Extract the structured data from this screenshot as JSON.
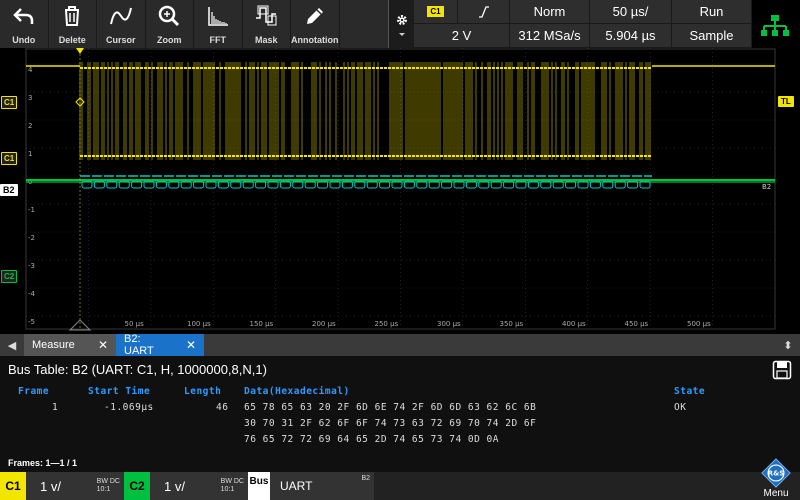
{
  "toolbar": {
    "buttons": [
      {
        "label": "Undo",
        "icon": "undo-icon"
      },
      {
        "label": "Delete",
        "icon": "trash-icon"
      },
      {
        "label": "Cursor",
        "icon": "cursor-icon"
      },
      {
        "label": "Zoom",
        "icon": "zoom-icon"
      },
      {
        "label": "FFT",
        "icon": "fft-icon"
      },
      {
        "label": "Mask",
        "icon": "mask-icon"
      },
      {
        "label": "Annotation",
        "icon": "pen-icon"
      }
    ]
  },
  "trigger": {
    "source": "C1",
    "slope": "rising-edge-icon",
    "mode": "Norm",
    "timebase": "50 µs/",
    "run_state": "Run",
    "level": "2 V",
    "sample_rate": "312 MSa/s",
    "position": "5.904 µs",
    "acq_mode": "Sample"
  },
  "scope": {
    "c1_label": "C1",
    "b2_label": "B2",
    "c2_label": "C2",
    "trigger_level_label": "TL",
    "bus_end_label": "B2",
    "y_ticks": [
      "4",
      "3",
      "2",
      "1",
      "0",
      "-1",
      "-2",
      "-3",
      "-4",
      "-5"
    ],
    "x_ticks": [
      "50 µs",
      "100 µs",
      "150 µs",
      "200 µs",
      "250 µs",
      "300 µs",
      "350 µs",
      "400 µs",
      "450 µs",
      "500 µs"
    ]
  },
  "tabs": [
    {
      "label": "Measure",
      "active": false
    },
    {
      "label": "B2: UART",
      "active": true
    }
  ],
  "bus_table": {
    "title": "Bus Table: B2 (UART: C1, H, 1000000,8,N,1)",
    "headers": {
      "frame": "Frame",
      "start_time": "Start Time",
      "length": "Length",
      "data": "Data(Hexadecimal)",
      "state": "State"
    },
    "rows": [
      {
        "frame": "1",
        "start_time": "-1.069µs",
        "length": "46",
        "data": [
          "65 78 65 63 20 2F 6D 6E 74 2F 6D 6D 63 62 6C 6B",
          "30 70 31 2F 62 6F 6F 74 73 63 72 69 70 74 2D 6F",
          "76 65 72 72 69 64 65 2D 74 65 73 74 0D 0A"
        ],
        "state": "OK"
      }
    ],
    "frames_info": "Frames:  1—1 / 1"
  },
  "channels": {
    "c1": {
      "tag": "C1",
      "scale": "1 v/",
      "bw": "BW DC",
      "probe": "10:1",
      "color": "#f2e600"
    },
    "c2": {
      "tag": "C2",
      "scale": "1 v/",
      "bw": "BW DC",
      "probe": "10:1",
      "color": "#00c040"
    },
    "bus": {
      "tag": "Bus",
      "name": "UART",
      "id": "B2"
    }
  },
  "menu": {
    "label": "Menu"
  },
  "colors": {
    "c1": "#f2e600",
    "c2": "#00c040",
    "bus": "#00c8c8",
    "accent": "#1a73c9"
  }
}
